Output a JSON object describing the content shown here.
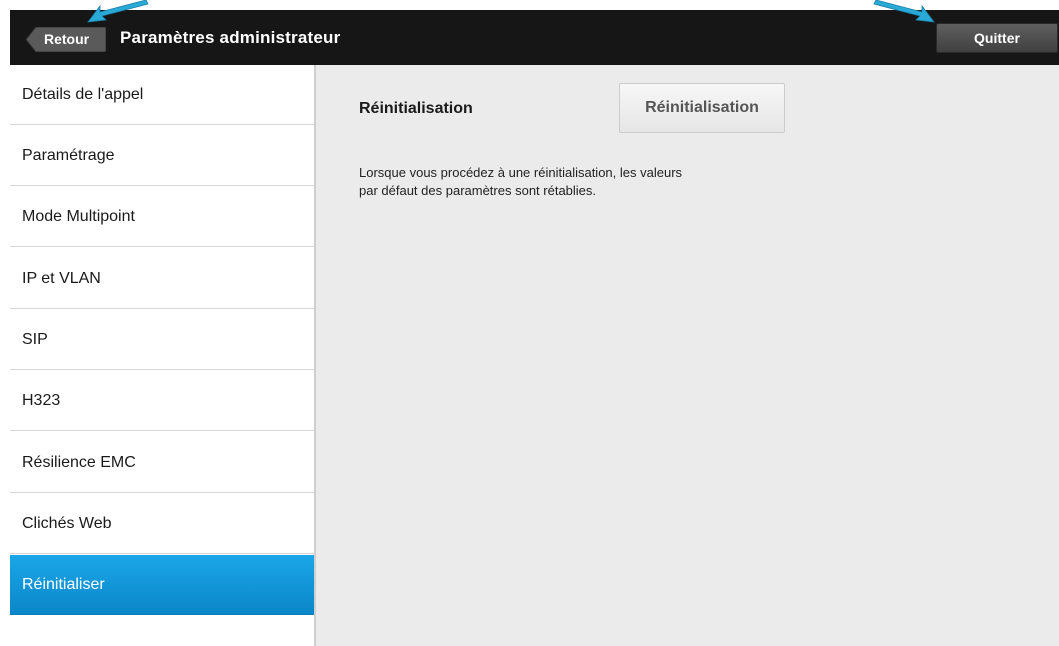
{
  "header": {
    "back_label": "Retour",
    "title": "Paramètres administrateur",
    "quit_label": "Quitter"
  },
  "sidebar": {
    "items": [
      {
        "label": "Détails de l'appel"
      },
      {
        "label": "Paramétrage"
      },
      {
        "label": "Mode Multipoint"
      },
      {
        "label": "IP et VLAN"
      },
      {
        "label": "SIP"
      },
      {
        "label": "H323"
      },
      {
        "label": "Résilience EMC"
      },
      {
        "label": "Clichés  Web"
      },
      {
        "label": "Réinitialiser",
        "active": true
      },
      {
        "label": ""
      }
    ]
  },
  "main": {
    "reset_label": "Réinitialisation",
    "reset_button": "Réinitialisation",
    "description_line1": "Lorsque vous procédez à une réinitialisation, les valeurs",
    "description_line2": "par défaut des paramètres sont rétablies."
  },
  "colors": {
    "accent": "#1ba6e8",
    "annotation_arrow": "#29a9d6",
    "topbar": "#161616"
  },
  "icons": {
    "back": "back-arrow-icon",
    "annotation": "callout-arrow-icon"
  }
}
